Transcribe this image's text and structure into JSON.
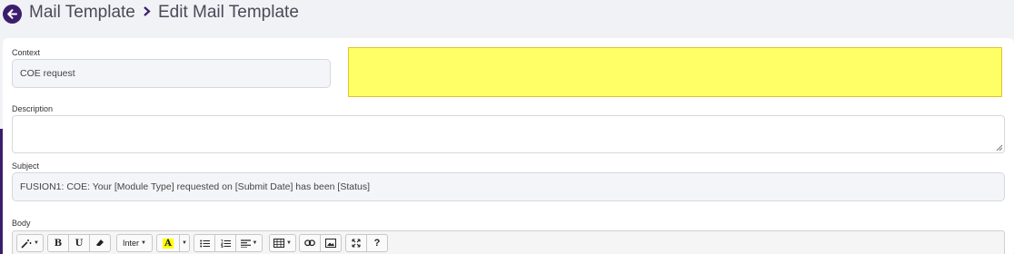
{
  "breadcrumb": {
    "parent": "Mail Template",
    "separator": ">",
    "current": "Edit Mail Template"
  },
  "form": {
    "context": {
      "label": "Context",
      "value": "COE request"
    },
    "description": {
      "label": "Description",
      "value": ""
    },
    "subject": {
      "label": "Subject",
      "value": "FUSION1: COE: Your [Module Type] requested on [Submit Date] has been [Status]"
    },
    "body": {
      "label": "Body"
    }
  },
  "toolbar": {
    "font_label": "Inter",
    "bold_label": "B",
    "underline_label": "U",
    "color_label": "A",
    "help_label": "?",
    "icons": [
      "magic-wand-icon",
      "bold-icon",
      "underline-icon",
      "eraser-icon",
      "font-dropdown",
      "text-color-icon",
      "unordered-list-icon",
      "ordered-list-icon",
      "align-icon",
      "table-icon",
      "link-icon",
      "picture-icon",
      "fullscreen-icon",
      "help-icon"
    ]
  },
  "colors": {
    "accent": "#3b1e6b",
    "highlight": "#ffff66",
    "page_bg": "#f1f2f6"
  }
}
